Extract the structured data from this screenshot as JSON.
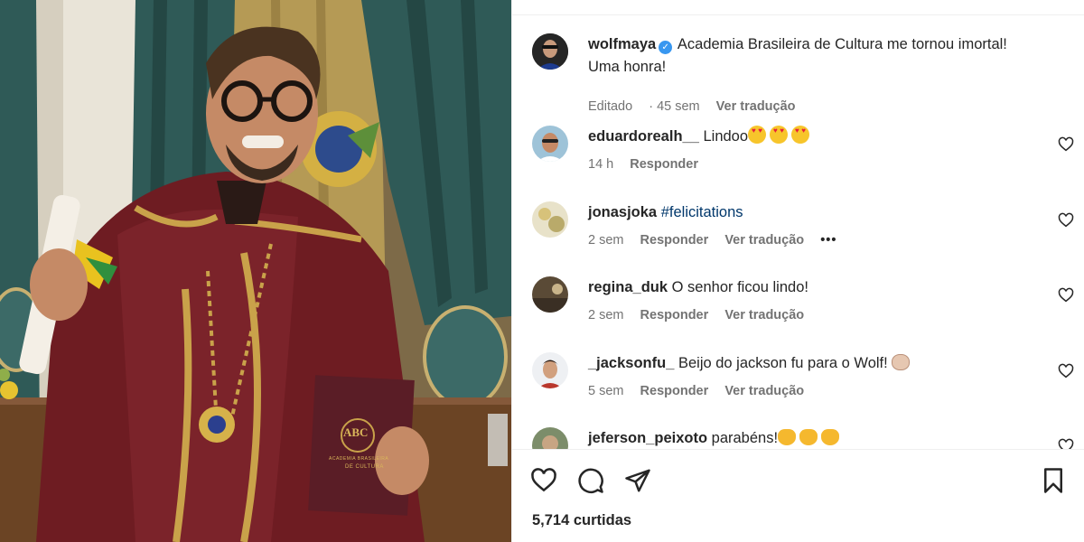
{
  "post": {
    "username": "wolfmaya",
    "caption": "Academia Brasileira de Cultura me tornou imortal! Uma honra!",
    "edited_label": "Editado",
    "age": "45 sem",
    "translate_label": "Ver tradução",
    "likes_text": "5,714 curtidas"
  },
  "booklet_text": {
    "monogram": "ABC",
    "line1": "ACADEMIA BRASILEIRA",
    "line2": "DE CULTURA"
  },
  "comments": [
    {
      "username": "eduardorealh__",
      "text": "Lindoo",
      "emoji": "heart-eyes-emoji x3",
      "time": "14 h",
      "reply_label": "Responder"
    },
    {
      "username": "jonasjoka",
      "text": "#felicitations",
      "time": "2 sem",
      "reply_label": "Responder",
      "translate_label": "Ver tradução",
      "more_label": "•••"
    },
    {
      "username": "regina_duk",
      "text": "O senhor ficou lindo!",
      "time": "2 sem",
      "reply_label": "Responder",
      "translate_label": "Ver tradução"
    },
    {
      "username": "_jacksonfu_",
      "text": "Beijo do jackson fu para o Wolf!",
      "emoji": "fist-emoji",
      "time": "5 sem",
      "reply_label": "Responder",
      "translate_label": "Ver tradução"
    },
    {
      "username": "jeferson_peixoto",
      "text": "parabéns!",
      "emoji": "clap-emoji x3"
    }
  ],
  "icons": {
    "verified": "verified-badge-icon",
    "like": "heart-icon",
    "comment": "comment-icon",
    "share": "send-icon",
    "save": "bookmark-icon"
  },
  "colors": {
    "link": "#00376b",
    "muted": "#737373",
    "verified": "#3897f0",
    "robe": "#6e1c22",
    "embroidery": "#c9a24a"
  }
}
